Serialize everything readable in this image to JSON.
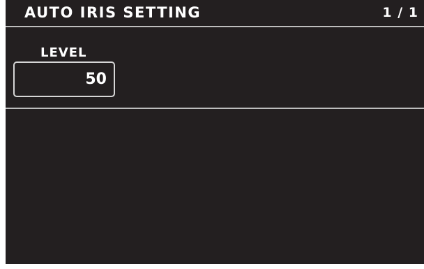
{
  "header": {
    "title": "AUTO IRIS SETTING",
    "page_indicator": "1 / 1"
  },
  "settings": {
    "level": {
      "label": "LEVEL",
      "value": "50"
    }
  },
  "colors": {
    "background": "#231f20",
    "text": "#ffffff",
    "divider": "#bdbdbd"
  }
}
